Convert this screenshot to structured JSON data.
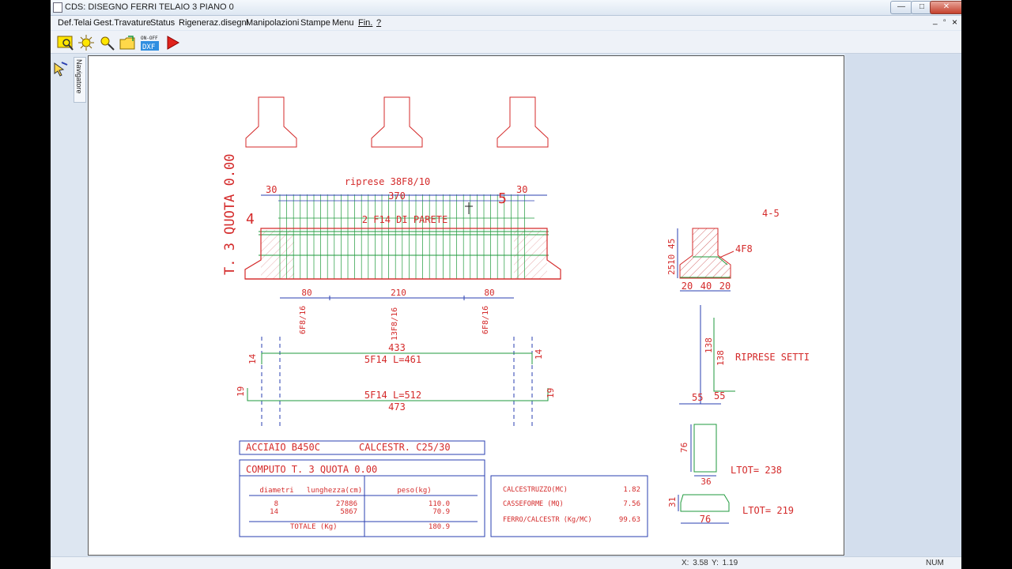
{
  "window": {
    "title": "CDS: DISEGNO FERRI TELAIO 3 PIANO 0",
    "controls": {
      "minimize": "—",
      "maximize": "□",
      "close": "✕",
      "mdi_minimize": "_",
      "mdi_restore": "▫",
      "mdi_close": "×"
    }
  },
  "menu": {
    "items": [
      "Def.Telai",
      "Gest.Travature",
      "Status",
      "Rigeneraz.disegni",
      "Manipolazioni",
      "Stampe",
      "Menu",
      "Fin.",
      "?"
    ]
  },
  "toolbar": {
    "onoff_label": "ON-OFF",
    "dxf_label": "DXF"
  },
  "navigator": {
    "label": "Navigatore"
  },
  "drawing": {
    "top_label": "riprese 38F8/10",
    "beam_span": "370",
    "end_left": "30",
    "end_right": "30",
    "node_left": "4",
    "node_right": "5",
    "wall_bars": "2 F14 DI PARETE",
    "level_text": "T. 3 QUOTA 0.00",
    "stirrup_spacing": [
      "80",
      "210",
      "80"
    ],
    "stirrup_labels": [
      "6F8/16",
      "13F8/16",
      "6F8/16"
    ],
    "bar1": {
      "length": "433",
      "label": "5F14 L=461",
      "hook": "14"
    },
    "bar2": {
      "length": "473",
      "label": "5F14 L=512",
      "hook": "19"
    },
    "section": {
      "name": "4-5",
      "rebar": "4F8",
      "h1": "45",
      "h2": "10",
      "h3": "25",
      "widths": [
        "20",
        "40",
        "20"
      ]
    },
    "setti": {
      "label": "RIPRESE SETTI",
      "h": "138",
      "w": "55"
    },
    "stirrup1": {
      "h": "76",
      "w": "36",
      "ltot": "LTOT= 238"
    },
    "stirrup2": {
      "h": "31",
      "w": "76",
      "ltot": "LTOT= 219"
    }
  },
  "materials": {
    "steel": "ACCIAIO  B450C",
    "concrete": "CALCESTR. C25/30"
  },
  "computo": {
    "title": "COMPUTO  T. 3 QUOTA  0.00",
    "headers": [
      "diametri",
      "lunghezza(cm)",
      "peso(kg)"
    ],
    "rows": [
      [
        "8",
        "27886",
        "110.0"
      ],
      [
        "14",
        "5867",
        "70.9"
      ]
    ],
    "total_label": "TOTALE  (Kg)",
    "total_value": "180.9"
  },
  "summary": {
    "rows": [
      {
        "label": "CALCESTRUZZO(MC)",
        "value": "1.82"
      },
      {
        "label": "CASSEFORME  (MQ)",
        "value": "7.56"
      },
      {
        "label": "FERRO/CALCESTR (Kg/MC)",
        "value": "99.63"
      }
    ]
  },
  "status": {
    "x": "X: 3.58",
    "y": "Y: 1.19",
    "num": "NUM"
  },
  "colors": {
    "drawing_red": "#d42a2a",
    "rebar_green": "#1f9a3c",
    "dim_blue": "#2a3fb0",
    "hatch": "#c84848"
  }
}
